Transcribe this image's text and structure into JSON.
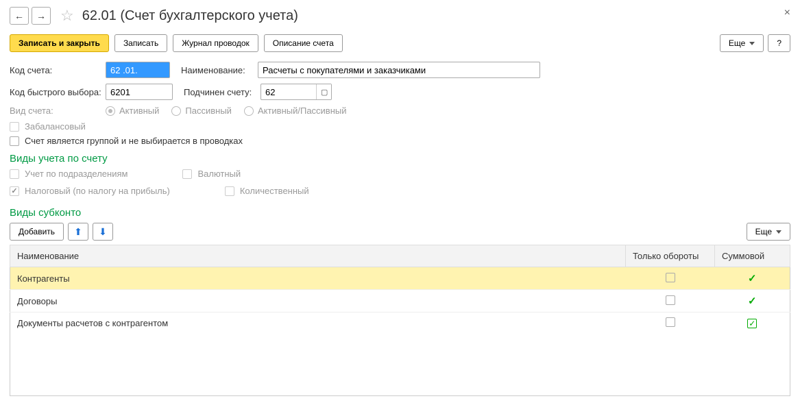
{
  "header": {
    "title": "62.01 (Счет бухгалтерского учета)"
  },
  "toolbar": {
    "save_close": "Записать и закрыть",
    "save": "Записать",
    "journal": "Журнал проводок",
    "description": "Описание счета",
    "more": "Еще",
    "help": "?"
  },
  "form": {
    "code_label": "Код счета:",
    "code_value": "62 .01.",
    "name_label": "Наименование:",
    "name_value": "Расчеты с покупателями и заказчиками",
    "quick_label": "Код быстрого выбора:",
    "quick_value": "6201",
    "parent_label": "Подчинен счету:",
    "parent_value": "62",
    "kind_label": "Вид счета:",
    "kind_active": "Активный",
    "kind_passive": "Пассивный",
    "kind_both": "Активный/Пассивный",
    "offbalance": "Забалансовый",
    "is_group": "Счет является группой и не выбирается в проводках"
  },
  "accounting_section": {
    "title": "Виды учета по счету",
    "by_dept": "Учет по подразделениям",
    "currency": "Валютный",
    "tax": "Налоговый (по налогу на прибыль)",
    "quantity": "Количественный"
  },
  "subkonto_section": {
    "title": "Виды субконто",
    "add": "Добавить",
    "more": "Еще",
    "columns": {
      "name": "Наименование",
      "turnover": "Только обороты",
      "sum": "Суммовой"
    },
    "rows": [
      {
        "name": "Контрагенты",
        "turnover": false,
        "sum_tick": true,
        "sum_boxed": false,
        "selected": true
      },
      {
        "name": "Договоры",
        "turnover": false,
        "sum_tick": true,
        "sum_boxed": false,
        "selected": false
      },
      {
        "name": "Документы расчетов с контрагентом",
        "turnover": false,
        "sum_tick": true,
        "sum_boxed": true,
        "selected": false
      }
    ]
  }
}
